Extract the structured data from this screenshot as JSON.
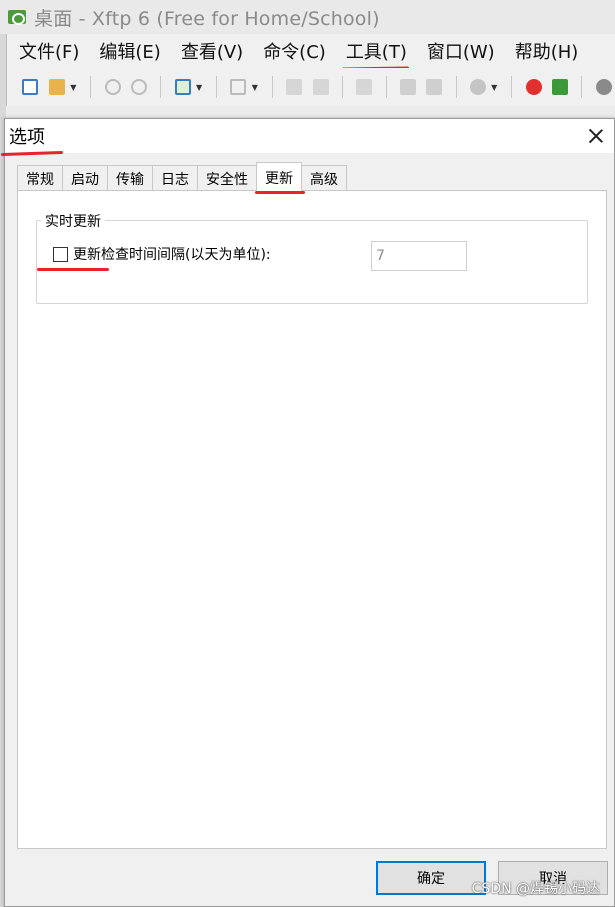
{
  "app": {
    "title": "桌面 - Xftp 6 (Free for Home/School)",
    "icon": "xftp-logo-icon"
  },
  "menubar": {
    "items": [
      {
        "label": "文件(F)"
      },
      {
        "label": "编辑(E)"
      },
      {
        "label": "查看(V)"
      },
      {
        "label": "命令(C)"
      },
      {
        "label": "工具(T)"
      },
      {
        "label": "窗口(W)"
      },
      {
        "label": "帮助(H)"
      }
    ]
  },
  "toolbar": {
    "icons": [
      "new-session-icon",
      "open-folder-icon",
      "disconnect-icon",
      "reconnect-icon",
      "session-manager-icon",
      "transfer-icon",
      "upload-icon",
      "download-icon",
      "sync-icon",
      "copy-icon",
      "paste-icon",
      "status-icon",
      "xshell-icon",
      "xftp-icon",
      "settings-icon"
    ]
  },
  "dialog": {
    "title": "选项",
    "tabs": [
      {
        "label": "常规"
      },
      {
        "label": "启动"
      },
      {
        "label": "传输"
      },
      {
        "label": "日志"
      },
      {
        "label": "安全性"
      },
      {
        "label": "更新",
        "active": true
      },
      {
        "label": "高级"
      }
    ],
    "group": {
      "legend": "实时更新",
      "checkbox_label": "更新检查时间间隔(以天为单位):",
      "checked": false,
      "interval_value": "7"
    },
    "buttons": {
      "ok": "确定",
      "cancel": "取消"
    },
    "watermark": "CSDN @焊锡小码达"
  },
  "colors": {
    "annotation_red": "#e8232a",
    "focus_blue": "#0078d7"
  }
}
